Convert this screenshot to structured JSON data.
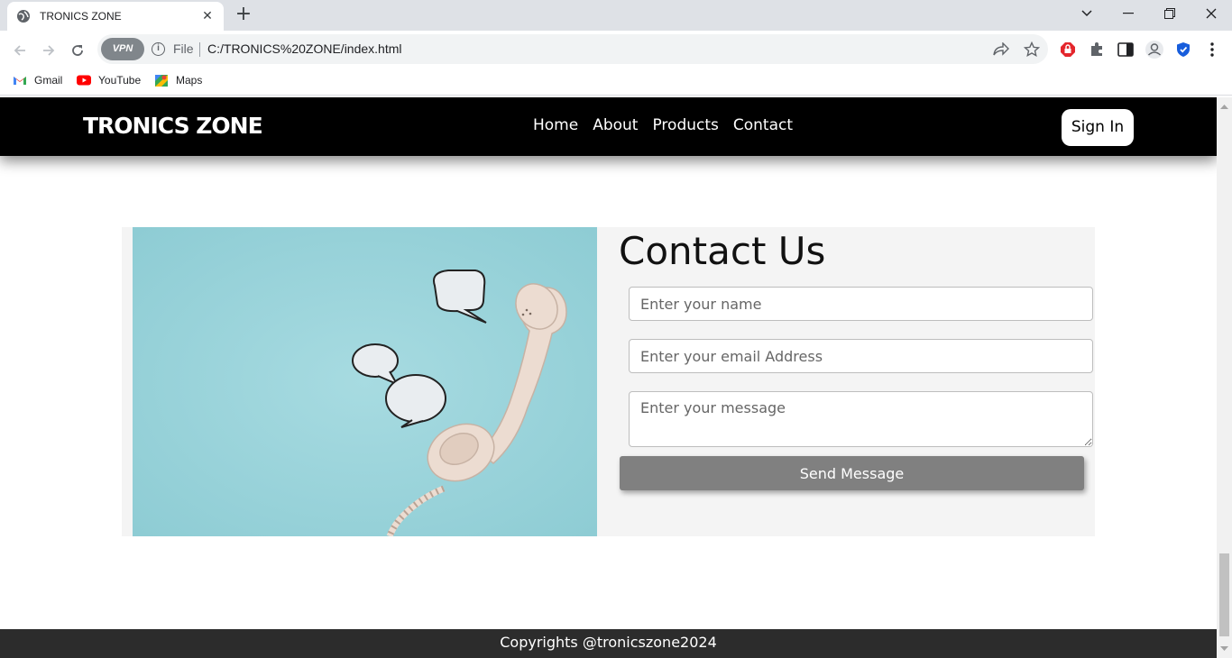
{
  "browser": {
    "tab_title": "TRONICS ZONE",
    "url_scheme_label": "File",
    "url": "C:/TRONICS%20ZONE/index.html",
    "vpn_label": "VPN",
    "bookmarks": [
      {
        "label": "Gmail",
        "icon": "gmail-icon"
      },
      {
        "label": "YouTube",
        "icon": "youtube-icon"
      },
      {
        "label": "Maps",
        "icon": "maps-icon"
      }
    ]
  },
  "navbar": {
    "logo": "TRONICS ZONE",
    "links": [
      "Home",
      "About",
      "Products",
      "Contact"
    ],
    "signin_label": "Sign In"
  },
  "contact": {
    "title": "Contact Us",
    "name_placeholder": "Enter your name",
    "email_placeholder": "Enter your email Address",
    "message_placeholder": "Enter your message",
    "send_label": "Send Message"
  },
  "footer": {
    "text": "Copyrights @tronicszone2024"
  },
  "colors": {
    "navbar_bg": "#000000",
    "footer_bg": "#2c2c2c",
    "send_button_bg": "#808080",
    "card_bg": "#f4f4f4",
    "photo_bg": "#9bd3da"
  }
}
